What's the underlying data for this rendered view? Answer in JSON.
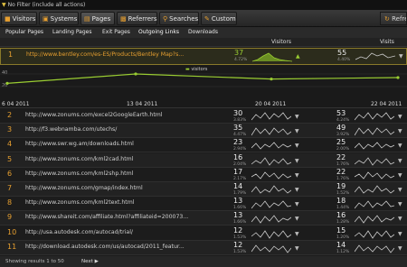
{
  "filterbar": {
    "text": "No Filter (include all actions)"
  },
  "nav": {
    "tabs": [
      {
        "label": "Visitors",
        "icon": "visitors-icon"
      },
      {
        "label": "Systems",
        "icon": "systems-icon"
      },
      {
        "label": "Pages",
        "icon": "pages-icon"
      },
      {
        "label": "Referrers",
        "icon": "referrers-icon"
      },
      {
        "label": "Searches",
        "icon": "searches-icon"
      },
      {
        "label": "Custom",
        "icon": "custom-icon"
      }
    ],
    "refresh_label": "Refresh"
  },
  "subnav": [
    "Popular Pages",
    "Landing Pages",
    "Exit Pages",
    "Outgoing Links",
    "Downloads"
  ],
  "columns": {
    "visitors": "Visitors",
    "visits": "Visits"
  },
  "chart": {
    "legend": "visitors",
    "y_ticks": [
      "40",
      "20"
    ],
    "x_ticks": [
      "6 04 2011",
      "13 04 2011",
      "20 04 2011",
      "22 04 2011"
    ]
  },
  "chart_data": {
    "type": "line",
    "x": [
      "6 04 2011",
      "13 04 2011",
      "20 04 2011",
      "22 04 2011"
    ],
    "series": [
      {
        "name": "visitors",
        "values": [
          22,
          35,
          28,
          30
        ]
      }
    ],
    "ylim": [
      0,
      45
    ]
  },
  "rows": [
    {
      "num": "1",
      "url": "http://www.bentley.com/es-ES/Products/Bentley Map?s...",
      "v": "37",
      "vp": "4.72%",
      "s": "55",
      "sp": "4.40%"
    },
    {
      "num": "2",
      "url": "http://www.zonums.com/excel2GoogleEarth.html",
      "v": "30",
      "vp": "3.83%",
      "s": "53",
      "sp": "4.24%"
    },
    {
      "num": "3",
      "url": "http://f3.webnamba.com/utechs/",
      "v": "35",
      "vp": "4.47%",
      "s": "49",
      "sp": "3.92%"
    },
    {
      "num": "4",
      "url": "http://www.swr.wg.am/downloads.html",
      "v": "23",
      "vp": "2.94%",
      "s": "25",
      "sp": "2.00%"
    },
    {
      "num": "5",
      "url": "http://www.zonums.com/kml2cad.html",
      "v": "16",
      "vp": "2.04%",
      "s": "22",
      "sp": "1.76%"
    },
    {
      "num": "6",
      "url": "http://www.zonums.com/kml2shp.html",
      "v": "17",
      "vp": "2.17%",
      "s": "22",
      "sp": "1.76%"
    },
    {
      "num": "7",
      "url": "http://www.zonums.com/gmap/index.html",
      "v": "14",
      "vp": "1.79%",
      "s": "19",
      "sp": "1.52%"
    },
    {
      "num": "8",
      "url": "http://www.zonums.com/kml2text.html",
      "v": "13",
      "vp": "1.66%",
      "s": "18",
      "sp": "1.44%"
    },
    {
      "num": "9",
      "url": "http://www.shareit.com/affiliate.html?affiliateid=200073...",
      "v": "13",
      "vp": "1.66%",
      "s": "16",
      "sp": "1.28%"
    },
    {
      "num": "10",
      "url": "http://usa.autodesk.com/autocad/trial/",
      "v": "12",
      "vp": "1.53%",
      "s": "15",
      "sp": "1.20%"
    },
    {
      "num": "11",
      "url": "http://download.autodesk.com/us/autocad/2011_featur...",
      "v": "12",
      "vp": "1.53%",
      "s": "14",
      "sp": "1.12%"
    }
  ],
  "footer": {
    "showing": "Showing results 1 to 50",
    "next": "Next"
  }
}
